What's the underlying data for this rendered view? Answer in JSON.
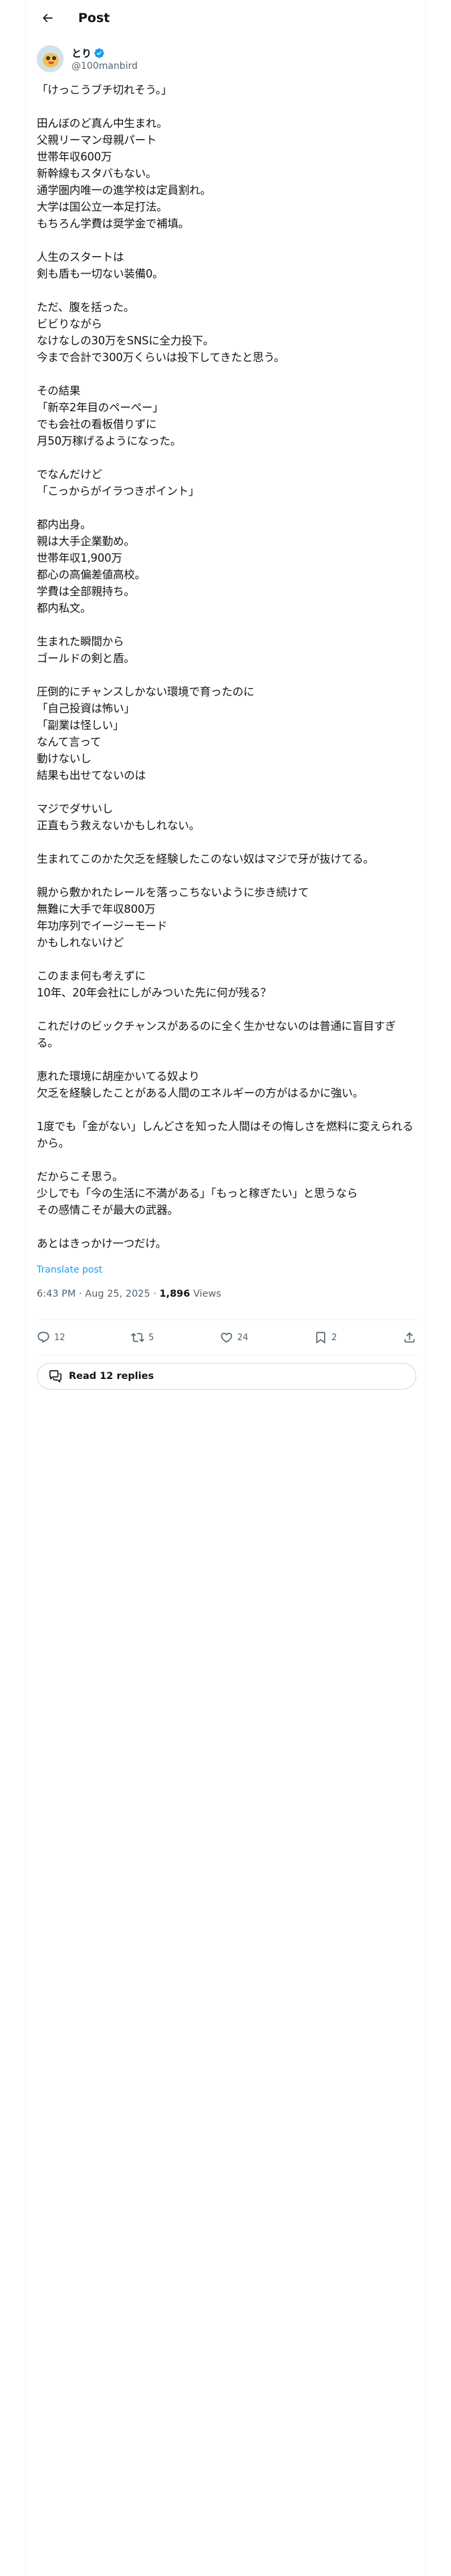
{
  "header": {
    "title": "Post",
    "back_icon": "back-arrow-icon"
  },
  "author": {
    "name": "とり",
    "handle": "@100manbird",
    "verified": true,
    "verified_color": "#1d9bf0"
  },
  "tweet": {
    "text": "「けっこうブチ切れそう。」\n\n田んぼのど真ん中生まれ。\n父親リーマン母親パート\n世帯年収600万\n新幹線もスタバもない。\n通学圏内唯一の進学校は定員割れ。\n大学は国公立一本足打法。\nもちろん学費は奨学金で補填。\n\n人生のスタートは\n剣も盾も一切ない装備0。\n\nただ、腹を括った。\nビビりながら\nなけなしの30万をSNSに全力投下。\n今まで合計で300万くらいは投下してきたと思う。\n\nその結果\n「新卒2年目のペーペー」\nでも会社の看板借りずに\n月50万稼げるようになった。\n\nでなんだけど\n「こっからがイラつきポイント」\n\n都内出身。\n親は大手企業勤め。\n世帯年収1,900万\n都心の高偏差値高校。\n学費は全部親持ち。\n都内私文。\n\n生まれた瞬間から\nゴールドの剣と盾。\n\n圧倒的にチャンスしかない環境で育ったのに\n「自己投資は怖い」\n「副業は怪しい」\nなんて言って\n動けないし\n結果も出せてないのは\n\nマジでダサいし\n正直もう救えないかもしれない。\n\n生まれてこのかた欠乏を経験したこのない奴はマジで牙が抜けてる。\n\n親から敷かれたレールを落っこちないように歩き続けて\n無難に大手で年収800万\n年功序列でイージーモード\nかもしれないけど\n\nこのまま何も考えずに\n10年、20年会社にしがみついた先に何が残る？\n\nこれだけのビックチャンスがあるのに全く生かせないのは普通に盲目すぎる。\n\n恵れた環境に胡座かいてる奴より\n欠乏を経験したことがある人間のエネルギーの方がはるかに強い。\n\n1度でも「金がない」しんどさを知った人間はその悔しさを燃料に変えられるから。\n\nだからこそ思う。\n少しでも「今の生活に不満がある」「もっと稼ぎたい」と思うなら\nその感情こそが最大の武器。\n\nあとはきっかけ一つだけ。",
    "translate_label": "Translate post",
    "time": "6:43 PM",
    "date": "Aug 25, 2025",
    "separator": "·",
    "views_count": "1,896",
    "views_label": "Views"
  },
  "actions": {
    "replies": "12",
    "reposts": "5",
    "likes": "24",
    "bookmarks": "2",
    "icons": [
      "reply-icon",
      "repost-icon",
      "like-icon",
      "bookmark-icon",
      "share-icon"
    ]
  },
  "read_replies_label": "Read 12 replies",
  "colors": {
    "text": "#0f1419",
    "secondary": "#536471",
    "accent": "#1d9bf0",
    "border": "#eff3f4"
  }
}
